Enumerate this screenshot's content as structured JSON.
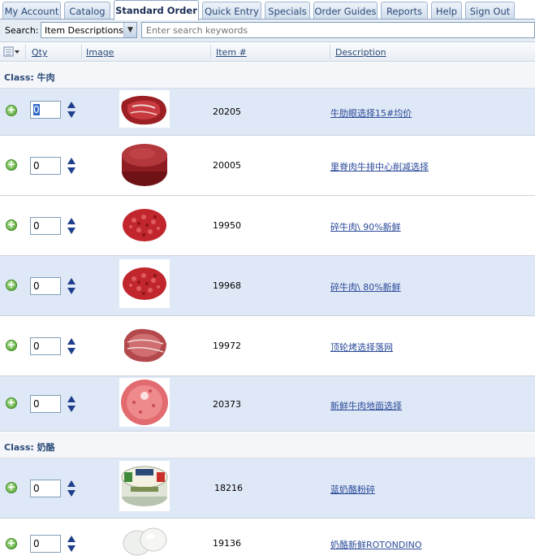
{
  "tabs": [
    {
      "label": "My Account"
    },
    {
      "label": "Catalog"
    },
    {
      "label": "Standard Order",
      "active": true
    },
    {
      "label": "Quick Entry"
    },
    {
      "label": "Specials"
    },
    {
      "label": "Order Guides"
    },
    {
      "label": "Reports"
    },
    {
      "label": "Help"
    },
    {
      "label": "Sign Out"
    }
  ],
  "search": {
    "label": "Search:",
    "mode": "Item Descriptions",
    "placeholder": "Enter search keywords"
  },
  "columns": {
    "qty": "Qty",
    "image": "Image",
    "item": "Item #",
    "description": "Description"
  },
  "groups": [
    {
      "class_label": "Class: 牛肉",
      "items": [
        {
          "qty": "0",
          "item": "20205",
          "description": "牛肋眼选择15#均价",
          "icon": "steak-image"
        },
        {
          "qty": "0",
          "item": "20005",
          "description": "里脊肉牛排中心削减选择",
          "icon": "filet-image"
        },
        {
          "qty": "0",
          "item": "19950",
          "description": "碎牛肉\\ 90%新鲜",
          "icon": "ground-beef-image"
        },
        {
          "qty": "0",
          "item": "19968",
          "description": "碎牛肉\\ 80%新鲜",
          "icon": "ground-beef-image"
        },
        {
          "qty": "0",
          "item": "19972",
          "description": "顶轮烤选择落网",
          "icon": "roast-image"
        },
        {
          "qty": "0",
          "item": "20373",
          "description": "新鲜牛肉地面选择",
          "icon": "ground-beef-image"
        }
      ]
    },
    {
      "class_label": "Class: 奶酪",
      "items": [
        {
          "qty": "0",
          "item": "18216",
          "description": "蓝奶酪粉碎",
          "icon": "blue-cheese-tub-image"
        },
        {
          "qty": "0",
          "item": "19136",
          "description": "奶酪新鲜ROTONDINO",
          "icon": "mozzarella-image"
        }
      ]
    }
  ],
  "colors": {
    "accent": "#2b4a78",
    "alt_row": "#dfe8f6",
    "link": "#2b4a9a"
  }
}
